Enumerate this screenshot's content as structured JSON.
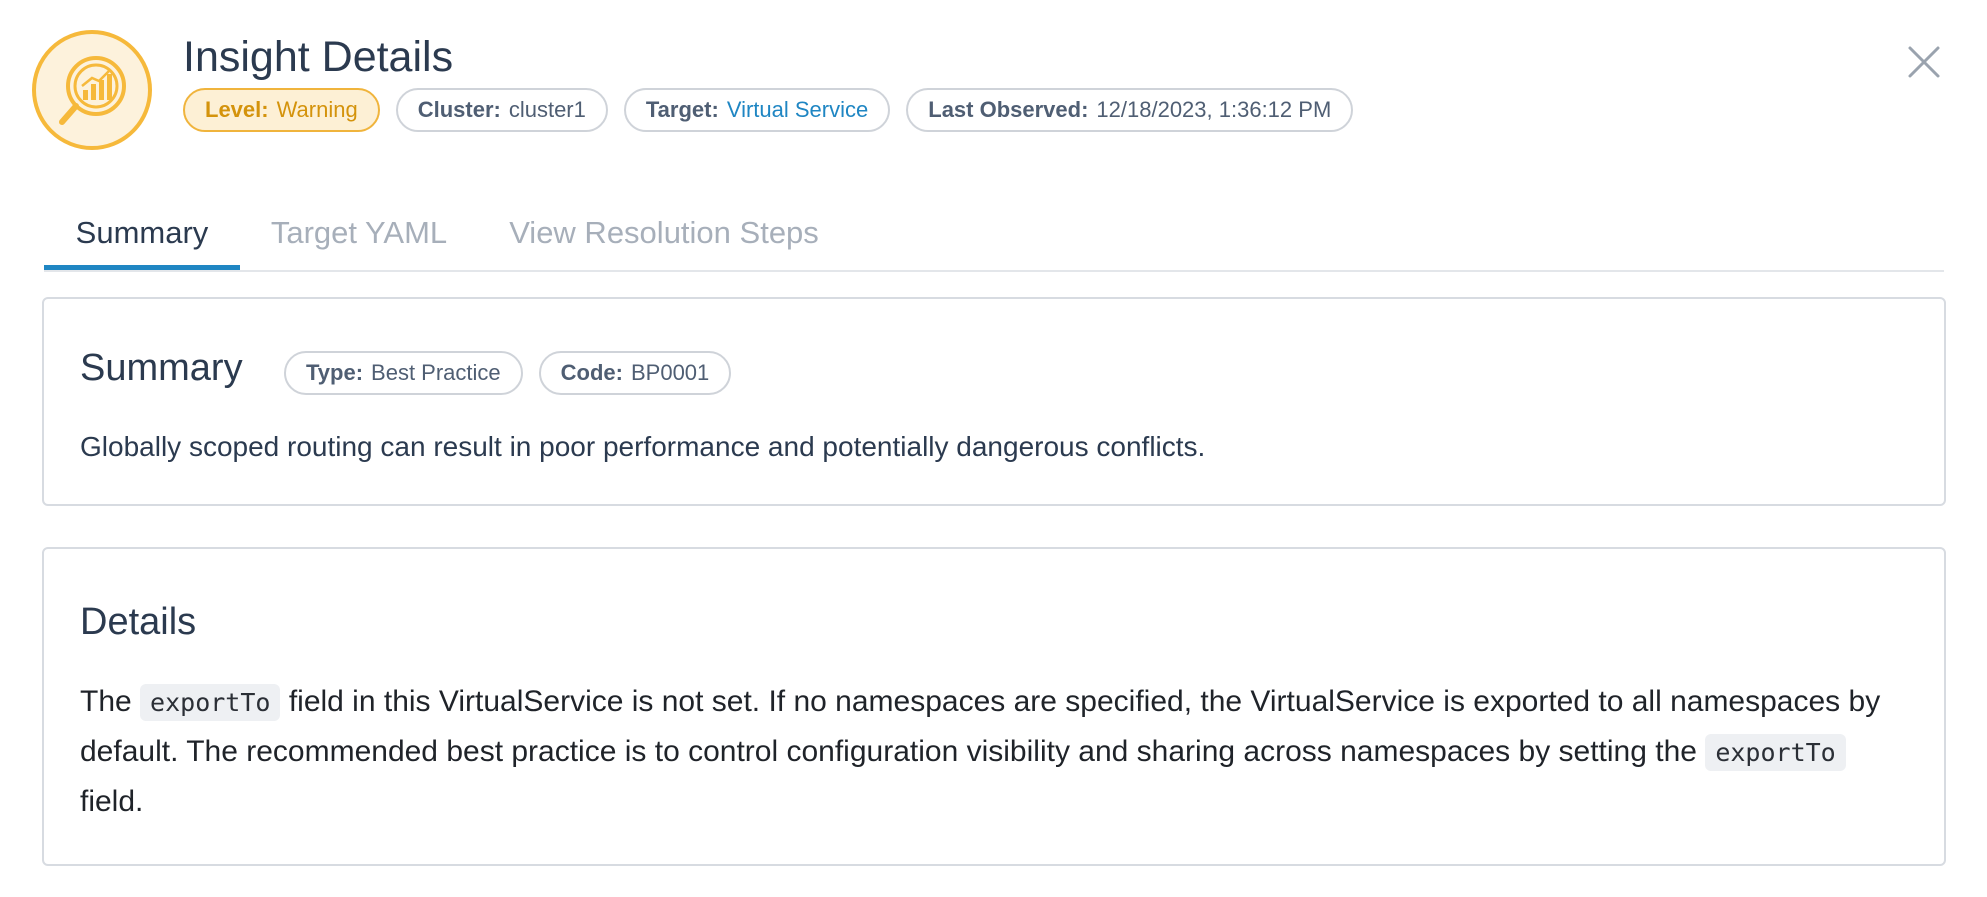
{
  "header": {
    "icon": "insight-chart-magnifier-icon",
    "title": "Insight Details",
    "chips": [
      {
        "key": "Level:",
        "value": "Warning"
      },
      {
        "key": "Cluster:",
        "value": "cluster1"
      },
      {
        "key": "Target:",
        "value": "Virtual Service"
      },
      {
        "key": "Last Observed:",
        "value": "12/18/2023, 1:36:12 PM"
      }
    ],
    "close_icon": "close-icon"
  },
  "tabs": [
    {
      "label": "Summary",
      "active": true
    },
    {
      "label": "Target YAML",
      "active": false
    },
    {
      "label": "View Resolution Steps",
      "active": false
    }
  ],
  "summary_card": {
    "title": "Summary",
    "chips": [
      {
        "key": "Type:",
        "value": "Best Practice"
      },
      {
        "key": "Code:",
        "value": "BP0001"
      }
    ],
    "text": "Globally scoped routing can result in poor performance and potentially dangerous conflicts."
  },
  "details_card": {
    "title": "Details",
    "p1": "The",
    "code1": "exportTo",
    "p2": "field in this VirtualService is not set. If no namespaces are specified, the VirtualService is exported to all namespaces by default. The recommended best practice is to control configuration visibility and sharing across namespaces by setting the",
    "code2": "exportTo",
    "p3": "field."
  },
  "colors": {
    "warning": "#f0b43c",
    "accent": "#1f86c3",
    "text": "#2b3a4f"
  }
}
